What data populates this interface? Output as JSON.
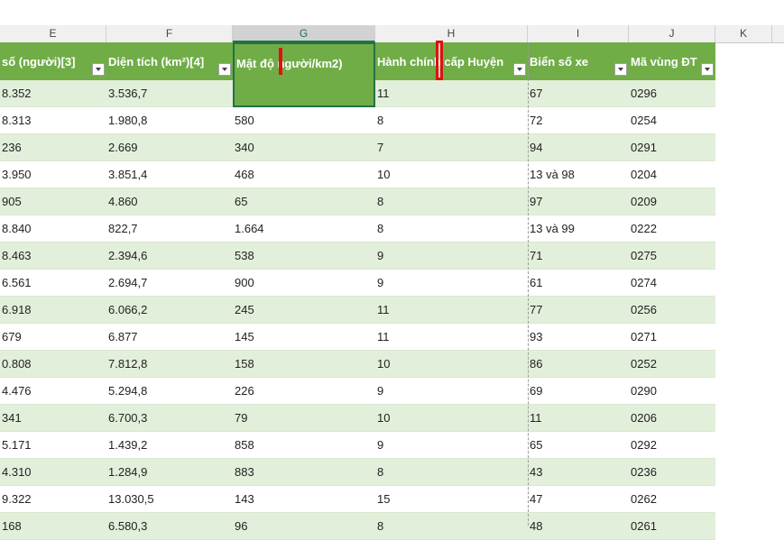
{
  "column_letters": [
    "E",
    "F",
    "G",
    "H",
    "I",
    "J",
    "K"
  ],
  "headers": {
    "E": "số (người)[3]",
    "F": "Diện tích (km²)[4]",
    "G": "Mật độ người/km2)",
    "H": "Hành chính cấp Huyện",
    "I": "Biển số xe",
    "J": "Mã vùng ĐT"
  },
  "rows": [
    {
      "E": "8.352",
      "F": "3.536,7",
      "G": "",
      "H": "11",
      "I": "67",
      "J": "0296"
    },
    {
      "E": "8.313",
      "F": "1.980,8",
      "G": "580",
      "H": "8",
      "I": "72",
      "J": "0254"
    },
    {
      "E": "236",
      "F": "2.669",
      "G": "340",
      "H": "7",
      "I": "94",
      "J": "0291"
    },
    {
      "E": "3.950",
      "F": "3.851,4",
      "G": "468",
      "H": "10",
      "I": "13 và 98",
      "J": "0204"
    },
    {
      "E": "905",
      "F": "4.860",
      "G": "65",
      "H": "8",
      "I": "97",
      "J": "0209"
    },
    {
      "E": "8.840",
      "F": "822,7",
      "G": "1.664",
      "H": "8",
      "I": "13 và 99",
      "J": "0222"
    },
    {
      "E": "8.463",
      "F": "2.394,6",
      "G": "538",
      "H": "9",
      "I": "71",
      "J": "0275"
    },
    {
      "E": "6.561",
      "F": "2.694,7",
      "G": "900",
      "H": "9",
      "I": "61",
      "J": "0274"
    },
    {
      "E": "6.918",
      "F": "6.066,2",
      "G": "245",
      "H": "11",
      "I": "77",
      "J": "0256"
    },
    {
      "E": "679",
      "F": "6.877",
      "G": "145",
      "H": "11",
      "I": "93",
      "J": "0271"
    },
    {
      "E": "0.808",
      "F": "7.812,8",
      "G": "158",
      "H": "10",
      "I": "86",
      "J": "0252"
    },
    {
      "E": "4.476",
      "F": "5.294,8",
      "G": "226",
      "H": "9",
      "I": "69",
      "J": "0290"
    },
    {
      "E": "341",
      "F": "6.700,3",
      "G": "79",
      "H": "10",
      "I": "11",
      "J": "0206"
    },
    {
      "E": "5.171",
      "F": "1.439,2",
      "G": "858",
      "H": "9",
      "I": "65",
      "J": "0292"
    },
    {
      "E": "4.310",
      "F": "1.284,9",
      "G": "883",
      "H": "8",
      "I": "43",
      "J": "0236"
    },
    {
      "E": "9.322",
      "F": "13.030,5",
      "G": "143",
      "H": "15",
      "I": "47",
      "J": "0262"
    },
    {
      "E": "168",
      "F": "6.580,3",
      "G": "96",
      "H": "8",
      "I": "48",
      "J": "0261"
    }
  ],
  "colors": {
    "header_green": "#70ad47",
    "band_green": "#e2efda",
    "marker_red": "#e01010"
  }
}
